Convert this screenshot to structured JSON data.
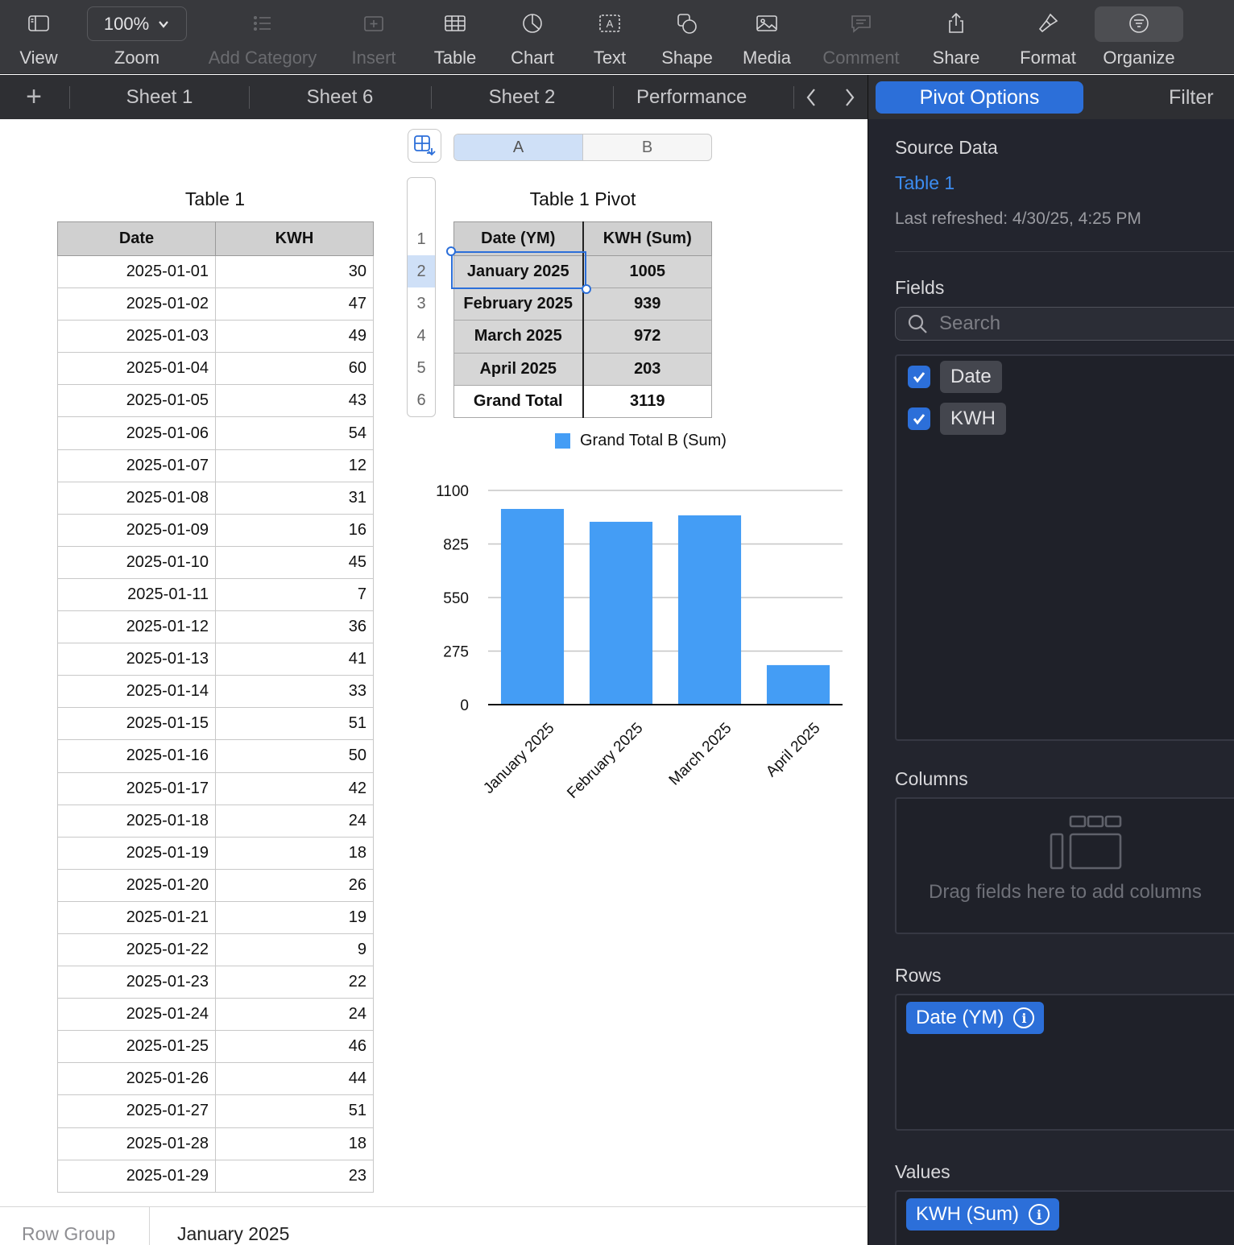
{
  "toolbar": {
    "view": "View",
    "zoom": "Zoom",
    "zoom_value": "100%",
    "add_category": "Add Category",
    "insert": "Insert",
    "table": "Table",
    "chart": "Chart",
    "text": "Text",
    "shape": "Shape",
    "media": "Media",
    "comment": "Comment",
    "share": "Share",
    "format": "Format",
    "organize": "Organize"
  },
  "tabs": [
    "Sheet 1",
    "Sheet 6",
    "Sheet 2",
    "Performance"
  ],
  "panel": {
    "tab_pivot": "Pivot Options",
    "tab_filter": "Filter",
    "source_data_heading": "Source Data",
    "source_table": "Table 1",
    "last_refreshed": "Last refreshed: 4/30/25, 4:25 PM",
    "fields_heading": "Fields",
    "search_placeholder": "Search",
    "fields": [
      "Date",
      "KWH"
    ],
    "columns_heading": "Columns",
    "columns_hint": "Drag fields here to add columns",
    "rows_heading": "Rows",
    "rows_field": "Date (YM)",
    "values_heading": "Values",
    "values_field": "KWH (Sum)"
  },
  "table1": {
    "title": "Table 1",
    "headers": [
      "Date",
      "KWH"
    ],
    "rows": [
      [
        "2025-01-01",
        "30"
      ],
      [
        "2025-01-02",
        "47"
      ],
      [
        "2025-01-03",
        "49"
      ],
      [
        "2025-01-04",
        "60"
      ],
      [
        "2025-01-05",
        "43"
      ],
      [
        "2025-01-06",
        "54"
      ],
      [
        "2025-01-07",
        "12"
      ],
      [
        "2025-01-08",
        "31"
      ],
      [
        "2025-01-09",
        "16"
      ],
      [
        "2025-01-10",
        "45"
      ],
      [
        "2025-01-11",
        "7"
      ],
      [
        "2025-01-12",
        "36"
      ],
      [
        "2025-01-13",
        "41"
      ],
      [
        "2025-01-14",
        "33"
      ],
      [
        "2025-01-15",
        "51"
      ],
      [
        "2025-01-16",
        "50"
      ],
      [
        "2025-01-17",
        "42"
      ],
      [
        "2025-01-18",
        "24"
      ],
      [
        "2025-01-19",
        "18"
      ],
      [
        "2025-01-20",
        "26"
      ],
      [
        "2025-01-21",
        "19"
      ],
      [
        "2025-01-22",
        "9"
      ],
      [
        "2025-01-23",
        "22"
      ],
      [
        "2025-01-24",
        "24"
      ],
      [
        "2025-01-25",
        "46"
      ],
      [
        "2025-01-26",
        "44"
      ],
      [
        "2025-01-27",
        "51"
      ],
      [
        "2025-01-28",
        "18"
      ],
      [
        "2025-01-29",
        "23"
      ]
    ]
  },
  "pivot": {
    "title": "Table 1 Pivot",
    "col_letters": [
      "A",
      "B"
    ],
    "row_numbers": [
      "1",
      "2",
      "3",
      "4",
      "5",
      "6"
    ],
    "headers": [
      "Date (YM)",
      "KWH (Sum)"
    ],
    "rows": [
      [
        "January 2025",
        "1005"
      ],
      [
        "February 2025",
        "939"
      ],
      [
        "March 2025",
        "972"
      ],
      [
        "April 2025",
        "203"
      ]
    ],
    "total": [
      "Grand Total",
      "3119"
    ]
  },
  "chart_data": {
    "type": "bar",
    "categories": [
      "January 2025",
      "February 2025",
      "March 2025",
      "April 2025"
    ],
    "series": [
      {
        "name": "Grand Total B (Sum)",
        "values": [
          1005,
          939,
          972,
          203
        ],
        "color": "#449df5"
      }
    ],
    "ylim": [
      0,
      1100
    ],
    "yticks": [
      0,
      275,
      550,
      825,
      1100
    ],
    "grid": true,
    "legend": "top"
  },
  "bottom_bar": {
    "label": "Row Group",
    "value": "January 2025"
  }
}
